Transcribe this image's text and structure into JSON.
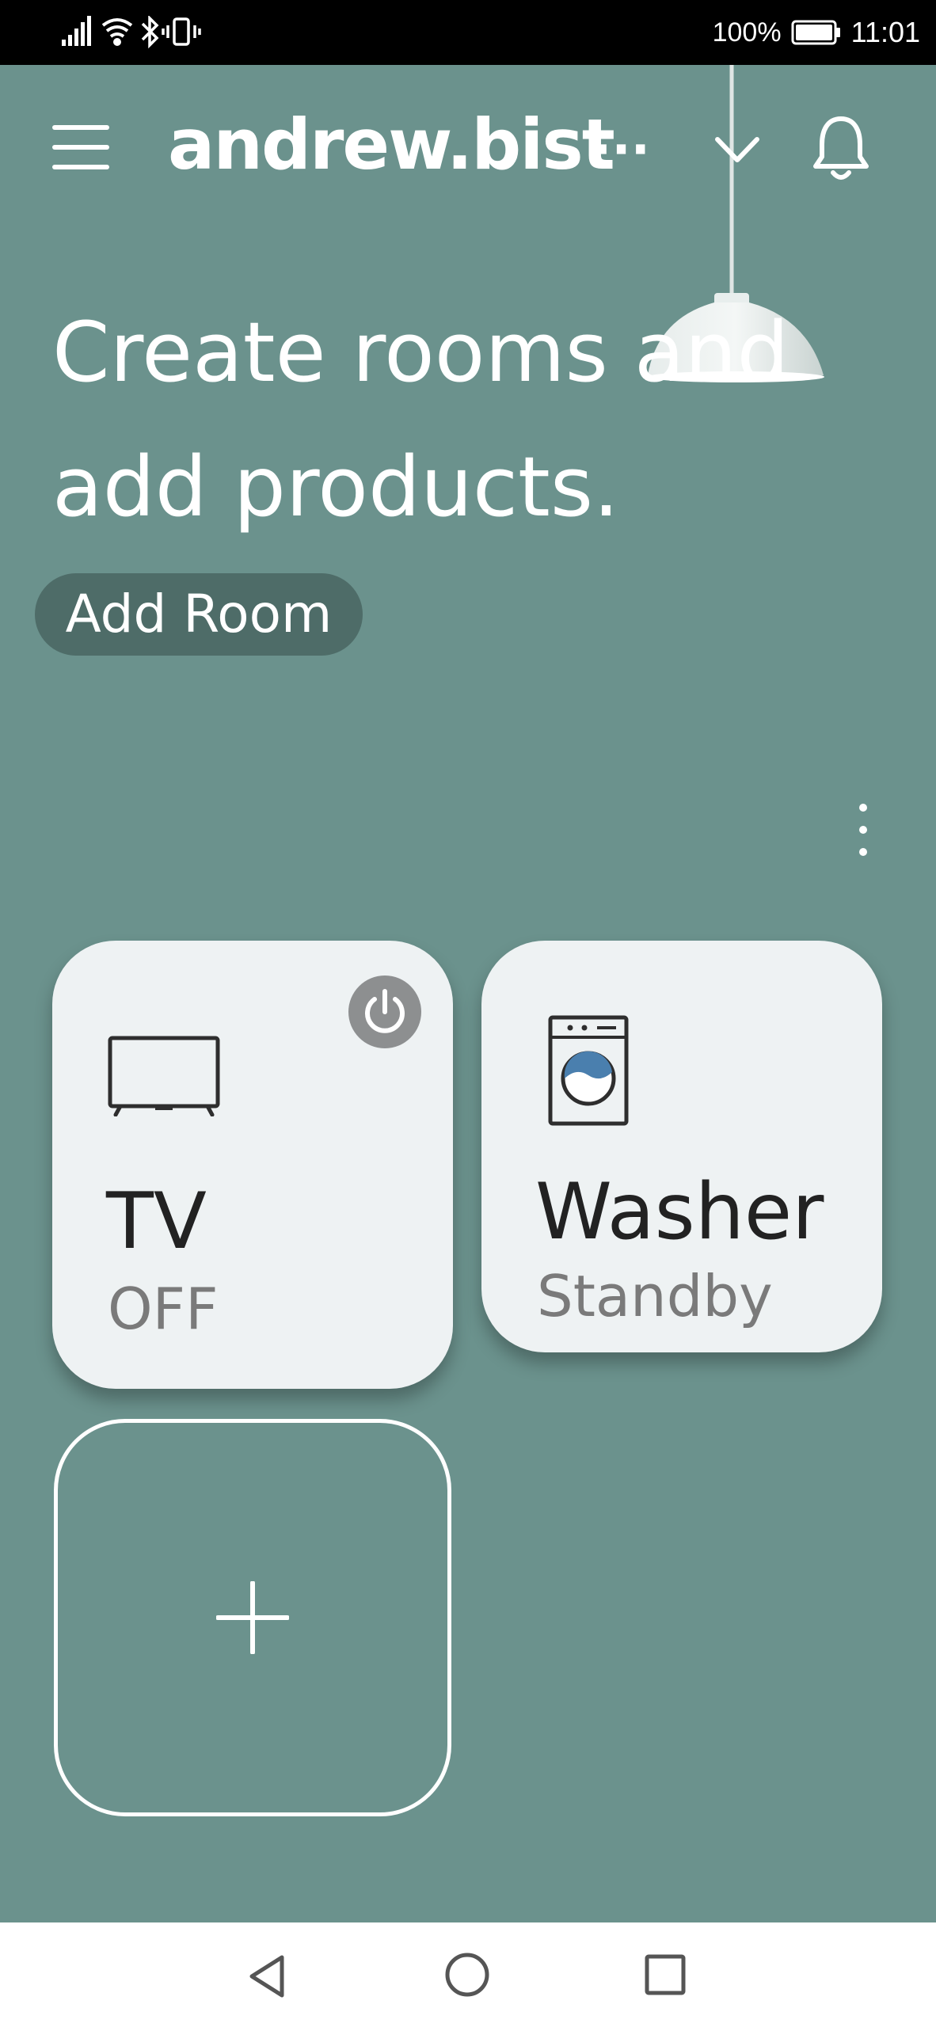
{
  "status_bar": {
    "battery_percent": "100%",
    "time": "11:01",
    "icons": [
      "signal-icon",
      "wifi-icon",
      "bluetooth-icon",
      "vibrate-icon",
      "battery-icon"
    ]
  },
  "header": {
    "account_name": "andrew.bist",
    "account_ellipsis": "···",
    "icons": [
      "menu-icon",
      "chevron-down-icon",
      "bell-icon"
    ]
  },
  "hero": {
    "headline_line1": "Create rooms and",
    "headline_line2": "add products.",
    "add_room_label": "Add Room"
  },
  "devices": [
    {
      "name": "TV",
      "status": "OFF",
      "icon": "tv-icon",
      "power_button": true
    },
    {
      "name": "Washer",
      "status": "Standby",
      "icon": "washer-icon",
      "power_button": false
    }
  ],
  "add_device": {
    "icon": "plus-icon"
  },
  "nav_bar": {
    "icons": [
      "back-icon",
      "home-icon",
      "recents-icon"
    ]
  },
  "colors": {
    "background": "#6b928d",
    "card": "#eef2f3",
    "add_room_button": "#4e6c68",
    "power_button": "#8d8f90",
    "washer_water": "#4a7fae"
  }
}
